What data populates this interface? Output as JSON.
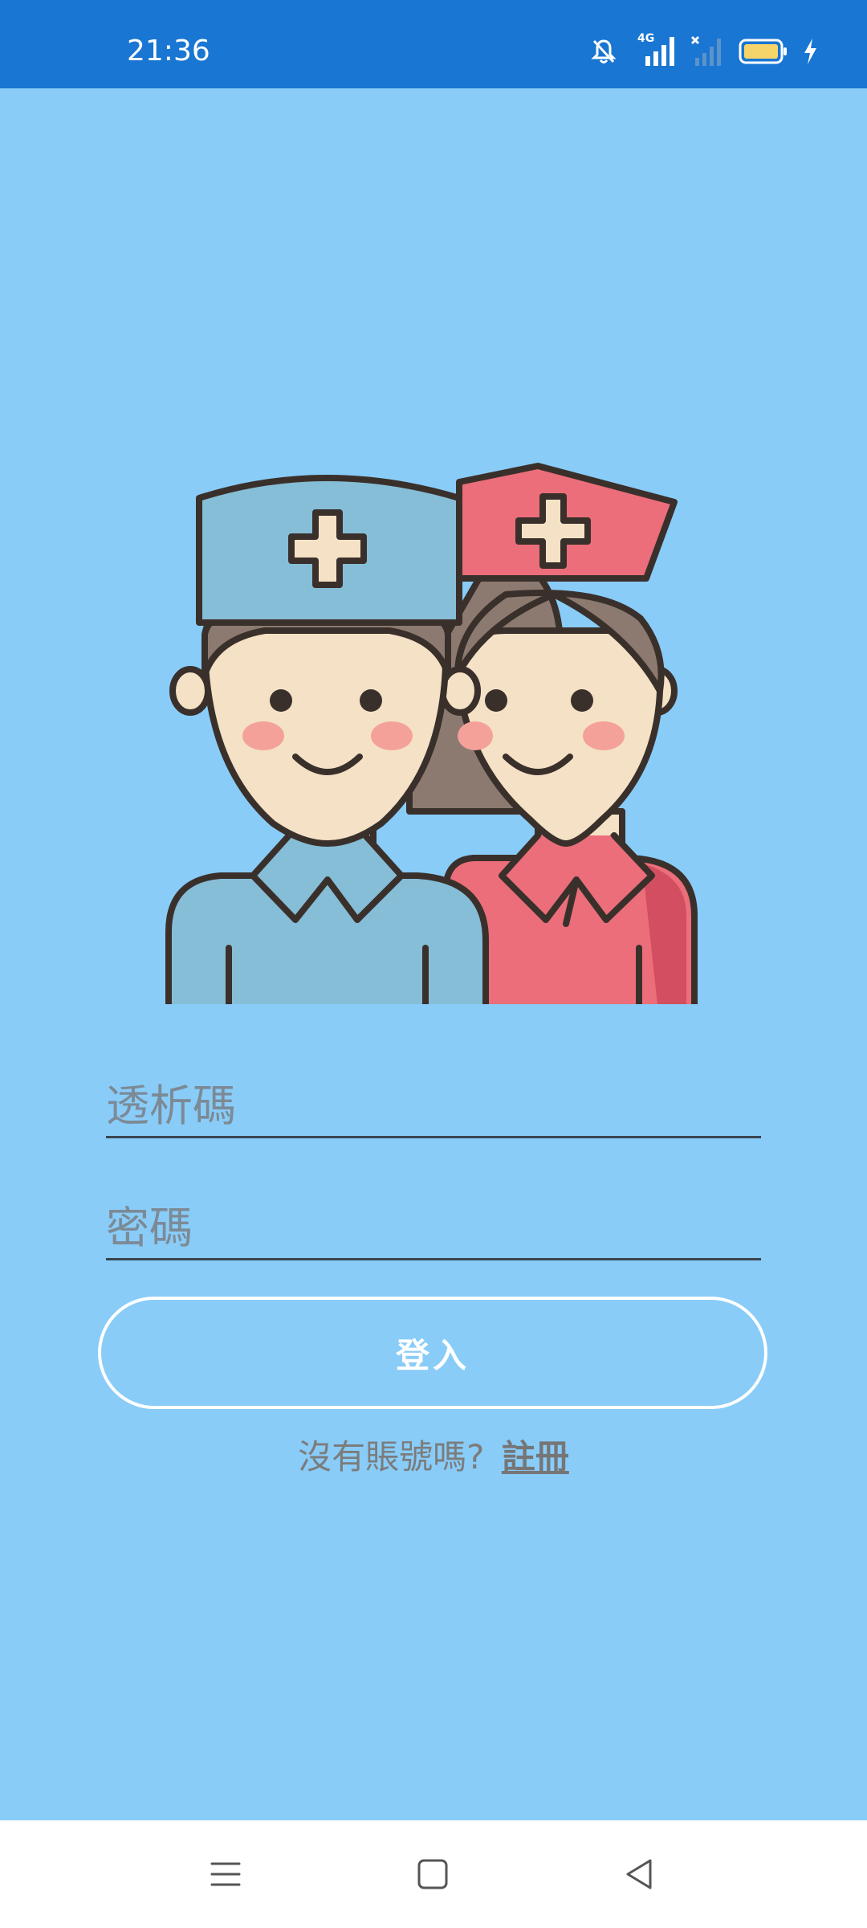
{
  "status_bar": {
    "time": "21:36",
    "network": "4G",
    "icons": [
      "bell-off-icon",
      "signal-4g-icon",
      "signal-empty-icon",
      "battery-icon",
      "charging-icon"
    ]
  },
  "illustration": {
    "icon": "doctor-nurse-illustration"
  },
  "form": {
    "id_placeholder": "透析碼",
    "id_value": "",
    "password_placeholder": "密碼",
    "password_value": "",
    "login_label": "登入"
  },
  "register": {
    "prompt": "沒有賬號嗎?",
    "link": "註冊"
  },
  "nav": {
    "icons": [
      "menu-icon",
      "home-icon",
      "back-icon"
    ]
  },
  "colors": {
    "status_bar": "#1976D2",
    "background": "#89CCF8",
    "nurse_red": "#EB6E7A",
    "doctor_blue": "#86BDD7",
    "skin": "#F5E1C5"
  }
}
